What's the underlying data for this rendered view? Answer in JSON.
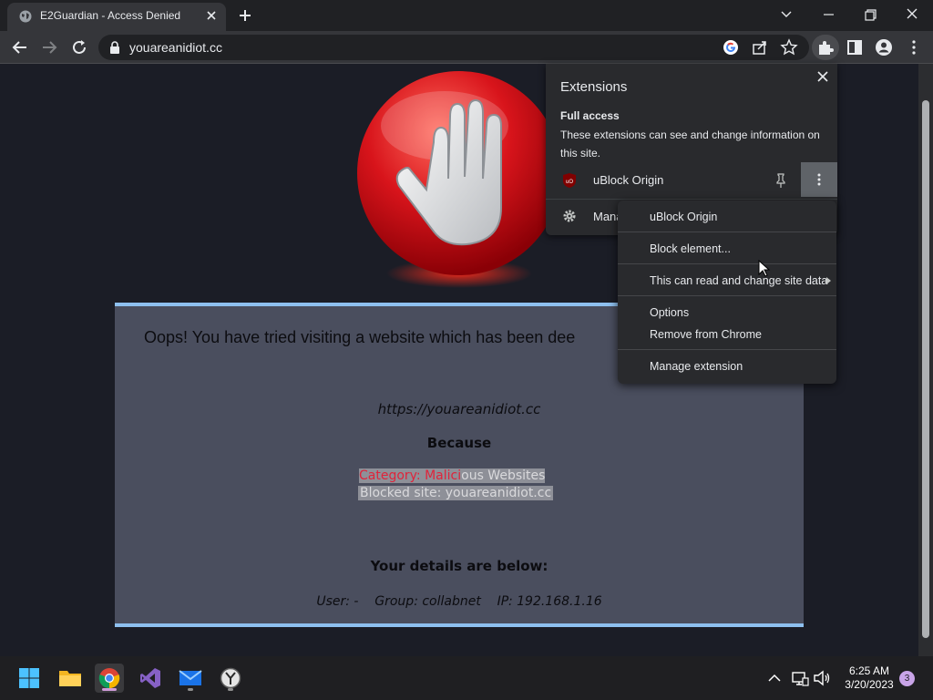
{
  "browser": {
    "tab_title": "E2Guardian - Access Denied",
    "url": "youareanidiot.cc"
  },
  "page": {
    "headline": "Oops! You have tried visiting a website which has been dee",
    "blocked_url": "https://youareanidiot.cc",
    "because": "Because",
    "category_prefix": "Category: Malici",
    "category_suffix": "ous Websites",
    "blocked_site": "Blocked site: youareanidiot.cc",
    "details_heading": "Your details are below:",
    "user_details": "User: -    Group: collabnet    IP: 192.168.1.16"
  },
  "extensions_popup": {
    "title": "Extensions",
    "section_heading": "Full access",
    "section_desc": "These extensions can see and change information on this site.",
    "extension_name": "uBlock Origin",
    "manage_label": "Mana"
  },
  "context_menu": {
    "items": [
      "uBlock Origin",
      "Block element...",
      "This can read and change site data",
      "Options",
      "Remove from Chrome",
      "Manage extension"
    ]
  },
  "taskbar": {
    "time": "6:25 AM",
    "date": "3/20/2023",
    "notification_count": "3"
  },
  "colors": {
    "panel_bg": "#4a4e5e",
    "panel_border": "#8ec0ef",
    "category_red": "#e0233a",
    "browser_frame": "#202124",
    "toolbar": "#35363a"
  }
}
